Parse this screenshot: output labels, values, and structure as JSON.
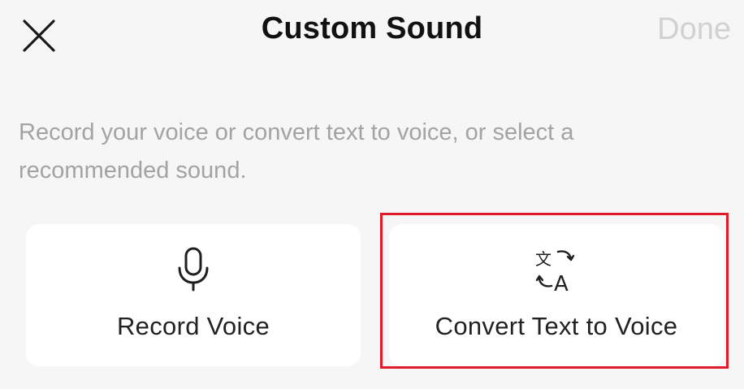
{
  "header": {
    "title": "Custom Sound",
    "done_label": "Done",
    "close_icon": "close-icon"
  },
  "description": "Record your voice or convert text to voice, or select a recommended sound.",
  "options": [
    {
      "label": "Record Voice",
      "icon": "microphone-icon"
    },
    {
      "label": "Convert Text to Voice",
      "icon": "translate-icon"
    }
  ],
  "colors": {
    "background": "#f6f6f6",
    "card": "#ffffff",
    "title": "#111111",
    "done_disabled": "#d1d1d1",
    "description": "#a3a3a3",
    "highlight": "#e01a2b"
  }
}
